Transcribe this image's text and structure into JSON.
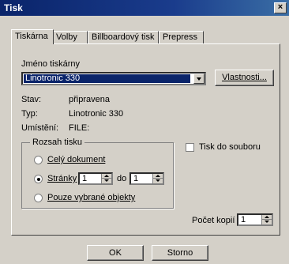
{
  "window": {
    "title": "Tisk",
    "close_glyph": "×"
  },
  "tabs": [
    {
      "label": "Tiskárna",
      "active": true
    },
    {
      "label": "Volby",
      "active": false
    },
    {
      "label": "Billboardový tisk",
      "active": false
    },
    {
      "label": "Prepress",
      "active": false
    }
  ],
  "printer": {
    "name_label": "Jméno tiskárny",
    "selected": "Linotronic 330",
    "properties_button": "Vlastnosti..."
  },
  "status": {
    "state_label": "Stav:",
    "state_value": "připravena",
    "type_label": "Typ:",
    "type_value": "Linotronic 330",
    "location_label": "Umístění:",
    "location_value": "FILE:"
  },
  "range": {
    "group_title": "Rozsah tisku",
    "all_label": "Celý dokument",
    "pages_label": "Stránky",
    "pages_from": "1",
    "to_label": "do",
    "pages_to": "1",
    "selection_label": "Pouze vybrané objekty",
    "selected_option": "pages"
  },
  "print_to_file": {
    "label": "Tisk do souboru",
    "checked": false
  },
  "copies": {
    "label": "Počet kopií",
    "value": "1"
  },
  "buttons": {
    "ok": "OK",
    "cancel": "Storno"
  },
  "colors": {
    "title_bar": "#0a246a",
    "face": "#d4d0c8",
    "highlight": "#0a246a"
  }
}
